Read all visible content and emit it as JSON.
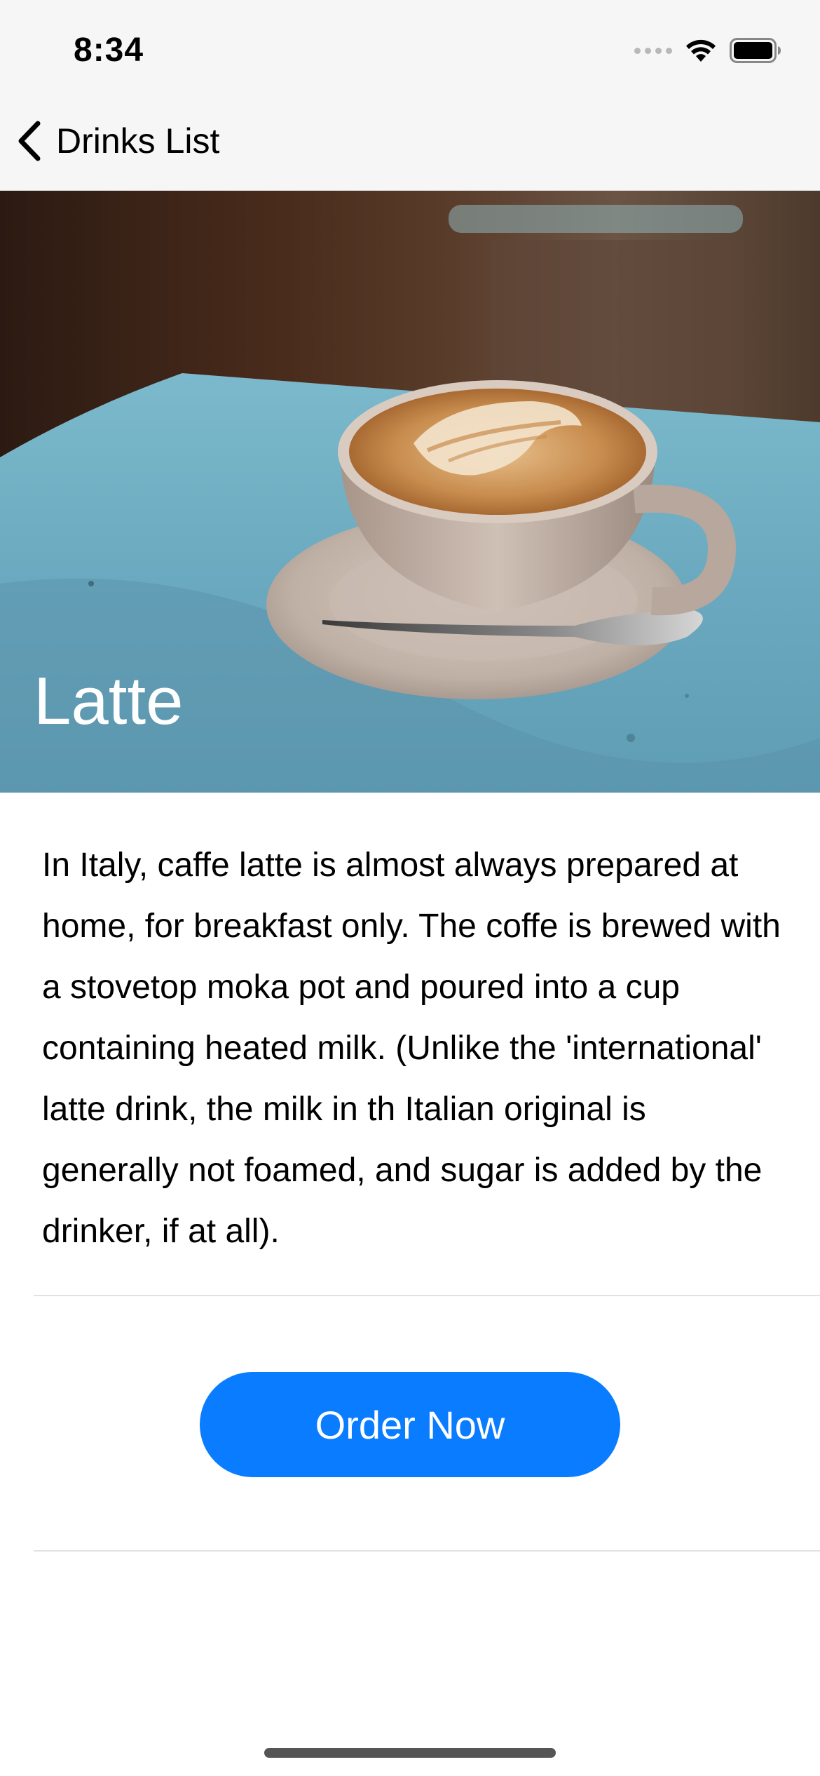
{
  "status_bar": {
    "time": "8:34",
    "signal_icon": "cellular-signal-icon",
    "wifi_icon": "wifi-icon",
    "battery_icon": "battery-icon"
  },
  "nav": {
    "back_icon": "chevron-left-icon",
    "back_label": "Drinks List"
  },
  "drink": {
    "name": "Latte",
    "description": "In Italy, caffe latte is almost always prepared at home, for breakfast only. The coffe is brewed with a stovetop moka pot and poured into a cup containing heated milk. (Unlike the 'international' latte drink, the milk in th Italian original is generally not foamed, and sugar is added by the drinker, if at all).",
    "order_button_label": "Order Now"
  },
  "colors": {
    "accent": "#0a7cff",
    "nav_background": "#f6f6f6"
  }
}
